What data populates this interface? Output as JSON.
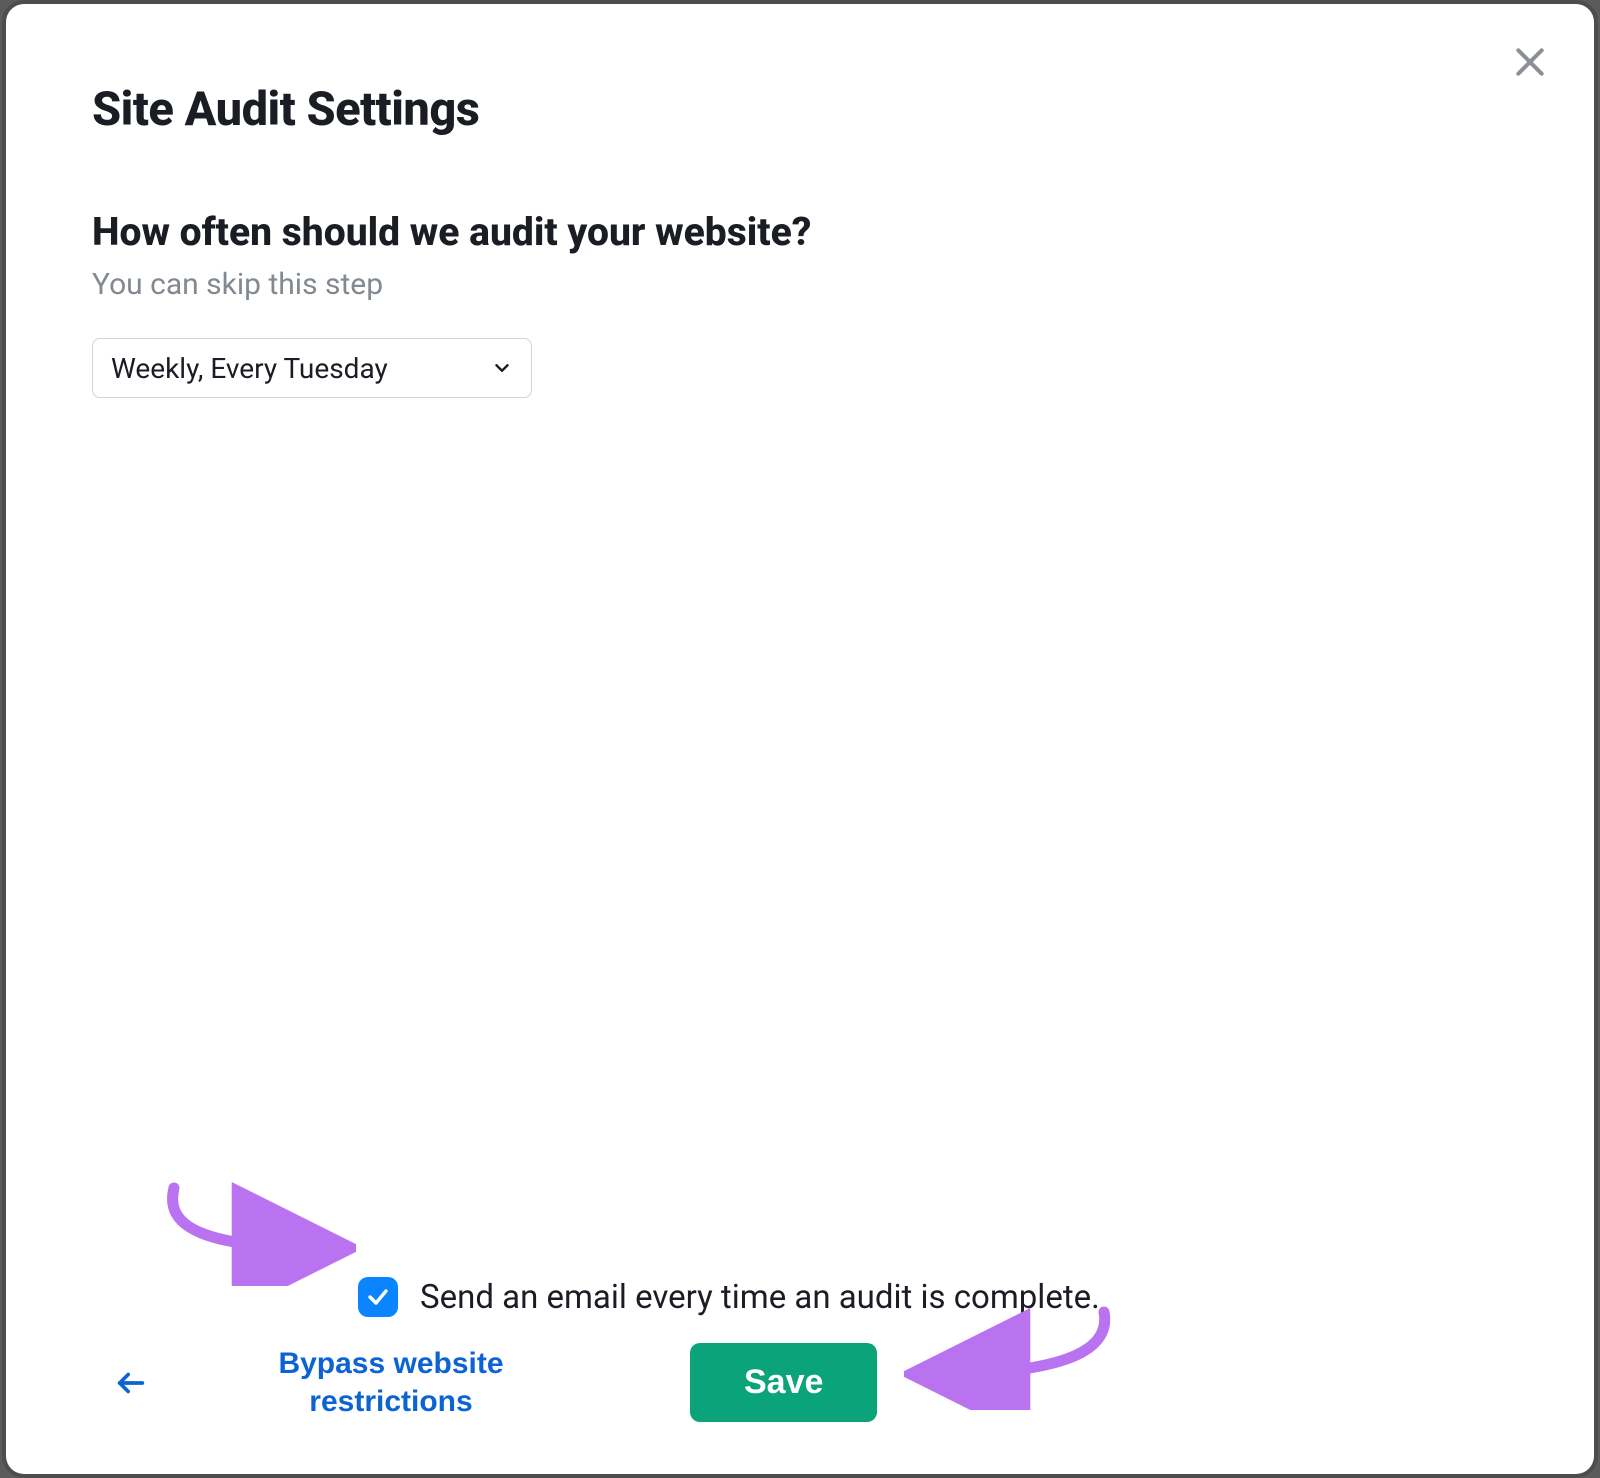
{
  "modal": {
    "title": "Site Audit Settings",
    "question": "How often should we audit your website?",
    "skip_note": "You can skip this step",
    "frequency_selected": "Weekly, Every Tuesday"
  },
  "footer": {
    "checkbox_checked": true,
    "email_label": "Send an email every time an audit is complete.",
    "bypass_label": "Bypass website restrictions",
    "save_label": "Save"
  },
  "colors": {
    "accent_blue": "#0a84ff",
    "link_blue": "#0c63d4",
    "save_green": "#0aa37a",
    "annotation_purple": "#b973f0"
  }
}
